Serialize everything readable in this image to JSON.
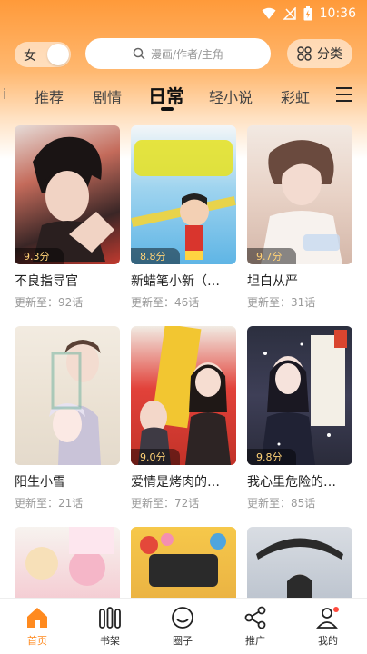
{
  "status_bar": {
    "time": "10:36"
  },
  "header": {
    "gender_label": "女",
    "search_placeholder": "漫画/作者/主角",
    "category_label": "分类"
  },
  "tabs": {
    "edge": "i",
    "items": [
      "推荐",
      "剧情",
      "日常",
      "轻小说",
      "彩虹"
    ],
    "active_index": 2
  },
  "comics": [
    {
      "title": "不良指导官",
      "score": "9.3分",
      "update": "更新至：92话"
    },
    {
      "title": "新蜡笔小新（…",
      "score": "8.8分",
      "update": "更新至：46话"
    },
    {
      "title": "坦白从严",
      "score": "9.7分",
      "update": "更新至：31话"
    },
    {
      "title": "阳生小雪",
      "score": "",
      "update": "更新至：21话"
    },
    {
      "title": "爱情是烤肉的…",
      "score": "9.0分",
      "update": "更新至：72话"
    },
    {
      "title": "我心里危险的…",
      "score": "9.8分",
      "update": "更新至：85话"
    }
  ],
  "bottom_nav": {
    "items": [
      "首页",
      "书架",
      "圈子",
      "推广",
      "我的"
    ],
    "active_index": 0
  },
  "colors": {
    "accent": "#ff8a1f",
    "header_gradient_top": "#ff9a3a"
  }
}
